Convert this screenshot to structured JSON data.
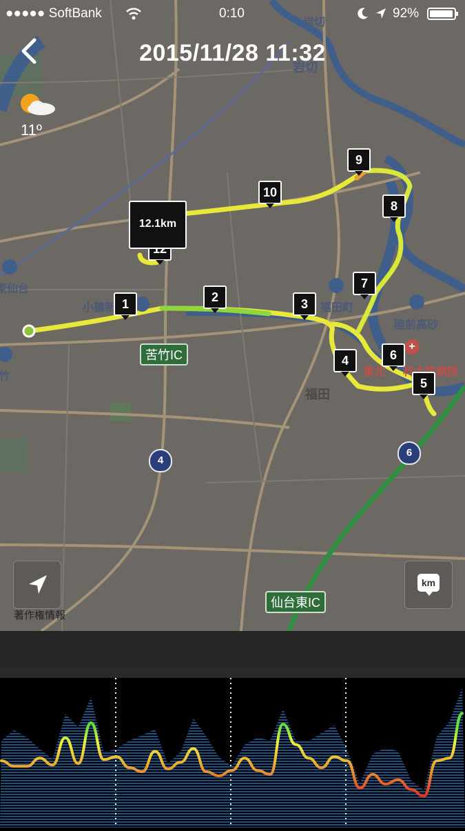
{
  "status_bar": {
    "carrier": "●●●●● SoftBank",
    "time": "0:10",
    "battery": "92%"
  },
  "header": {
    "title": "2015/11/28  11:32",
    "back_icon": "chevron-left-icon"
  },
  "weather": {
    "icon": "partly-cloudy-icon",
    "temperature": "11º"
  },
  "map": {
    "place_labels": [
      "岩切",
      "東仙台",
      "小鶴新",
      "福田町",
      "陸前高砂",
      "東北",
      "科大学病院",
      "福田",
      "竹"
    ],
    "top_label": "岩切",
    "ic_signs": [
      "苦竹IC",
      "仙台東IC"
    ],
    "route_shields": [
      "4",
      "6"
    ],
    "distance_callout": "12.1km",
    "km_markers": [
      "1",
      "2",
      "3",
      "4",
      "5",
      "6",
      "7",
      "8",
      "9",
      "10",
      "12"
    ],
    "locate_button_icon": "location-arrow-icon",
    "unit_button": "km",
    "copyright": "著作権情報",
    "colors": {
      "route_yellow": "#e8e83a",
      "route_green": "#8fd63a",
      "route_orange": "#e8a030",
      "start_marker": "#8cc43c",
      "river": "#3f5f8a",
      "highway": "#2f8f3f"
    }
  },
  "chart_data": {
    "type": "line",
    "series": [
      {
        "values": [
          4.3,
          3.9,
          3.9,
          4.5,
          4.0,
          6.0,
          4.1,
          7.1,
          4.4,
          4.6,
          3.8,
          3.5,
          5.0,
          3.7,
          4.2,
          5.2,
          3.5,
          3.2,
          3.6,
          4.5,
          3.6,
          3.3,
          7.0,
          5.5,
          4.5,
          3.8,
          4.6,
          4.3,
          2.3,
          3.3,
          2.6,
          2.9,
          2.2,
          1.7,
          4.3,
          4.5,
          7.8
        ]
      }
    ],
    "ylim": [
      0,
      10
    ],
    "colors": {
      "low": "#e03020",
      "mid": "#f0b030",
      "high": "#f0f040",
      "top": "#60e040",
      "elevation_fill": "#1f4f7f",
      "km_divider": "#ffffff"
    }
  }
}
